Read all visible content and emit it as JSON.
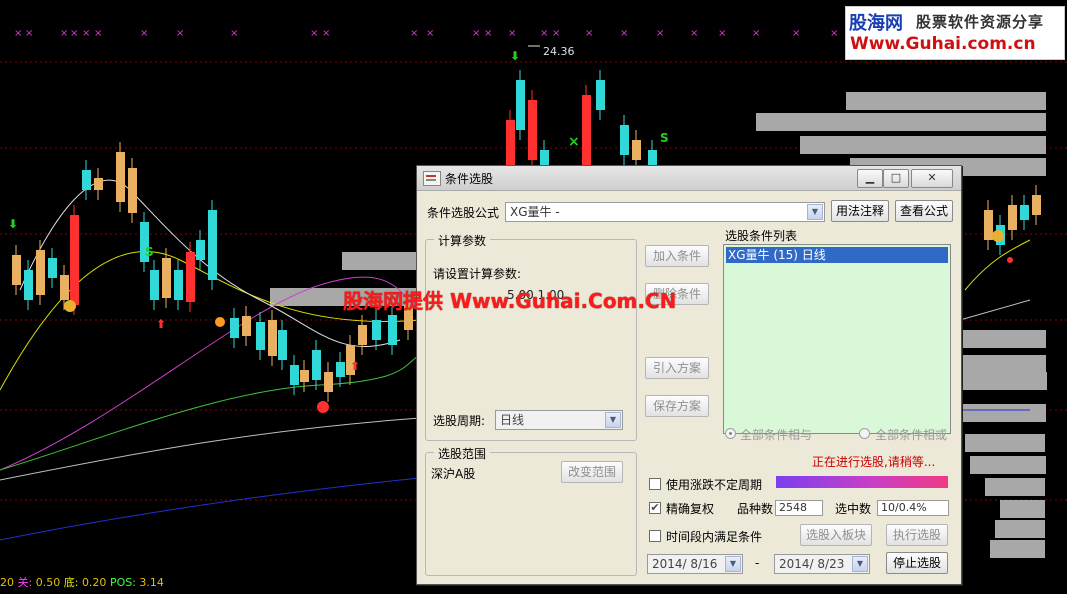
{
  "chart": {
    "peak_label": "24.36",
    "status": {
      "prefix": "20",
      "a_label": "关:",
      "a_value": "0.50",
      "b_label": "底:",
      "b_value": "0.20",
      "c_label": "POS:",
      "c_value": "3.14"
    }
  },
  "watermark": {
    "logo_line1": "股海网",
    "logo_line1_sub": "股票软件资源分享",
    "logo_line2": "Www.Guhai.com.cn",
    "overlay": "股海网提供 Www.Guhai.Com.CN"
  },
  "dialog": {
    "title": "条件选股",
    "formula_label": "条件选股公式",
    "formula_value": "XG量牛  -",
    "btn_usage": "用法注释",
    "btn_view_formula": "查看公式",
    "params_group": "计算参数",
    "params_prompt": "请设置计算参数:",
    "params_value": "5.00   1.00",
    "period_label": "选股周期:",
    "period_value": "日线",
    "scope_group": "选股范围",
    "scope_value": "深沪A股",
    "btn_change_scope": "改变范围",
    "btn_add_condition": "加入条件",
    "btn_delete_condition": "删除条件",
    "btn_import_plan": "引入方案",
    "btn_save_plan": "保存方案",
    "list_title": "选股条件列表",
    "list_items": [
      "XG量牛 (15) 日线"
    ],
    "radio_all_and": "全部条件相与",
    "radio_all_or": "全部条件相或",
    "status_text": "正在进行选股,请稍等...",
    "chk_uncertain_period": "使用涨跌不定周期",
    "chk_precise_adjust": "精确复权",
    "count_label": "品种数",
    "count_value": "2548",
    "selected_label": "选中数",
    "selected_value": "10/0.4%",
    "chk_time_range": "时间段内满足条件",
    "btn_to_block": "选股入板块",
    "btn_execute": "执行选股",
    "btn_stop": "停止选股",
    "date_from": "2014/ 8/16",
    "date_dash": "-",
    "date_to": "2014/ 8/23",
    "progress_fraction": 1.0
  }
}
